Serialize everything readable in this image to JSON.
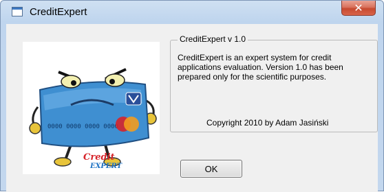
{
  "window": {
    "title": "CreditExpert"
  },
  "about": {
    "group_title": "CreditExpert v 1.0",
    "description": "CreditExpert is an expert system for credit applications evaluation. Version 1.0 has been prepared only for the scientific purposes.",
    "copyright": "Copyright 2010 by Adam Jasiński",
    "ok_label": "OK"
  },
  "logo": {
    "card_number": "0000 0000 0000 0000",
    "brand_top": "Credit",
    "brand_bottom": "EXPERT",
    "colors": {
      "card": "#3f8fd1",
      "brand_red": "#d6242a",
      "brand_blue": "#1d72c4"
    }
  },
  "icons": {
    "app": "app-window-icon",
    "close": "close-icon"
  }
}
